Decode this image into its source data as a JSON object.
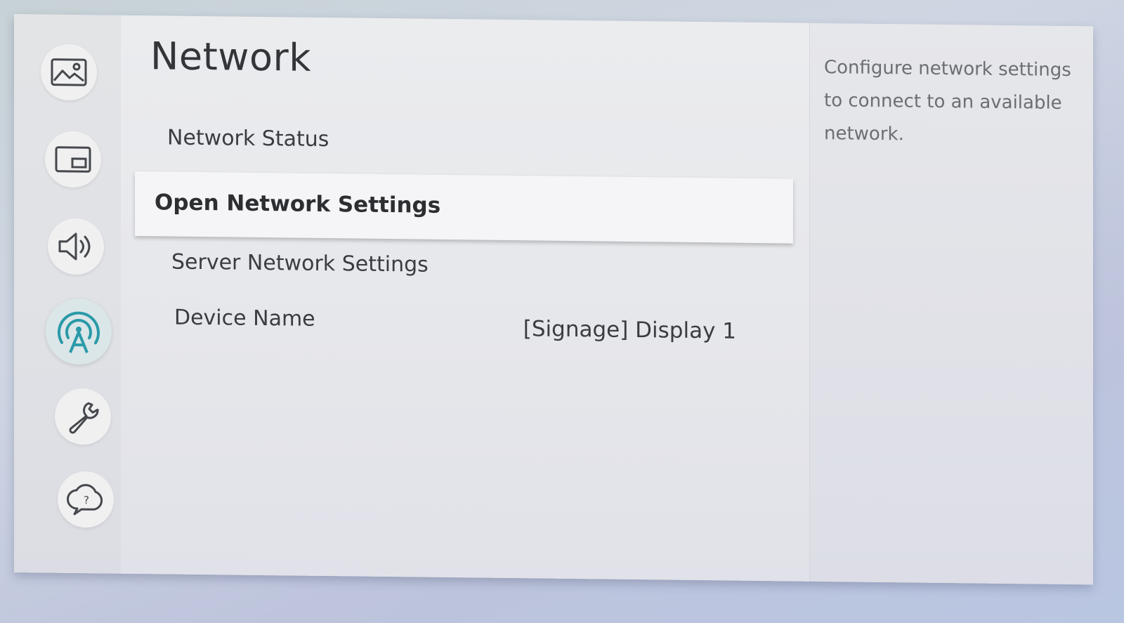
{
  "sidebar": {
    "items": [
      {
        "icon": "picture-icon",
        "label": ""
      },
      {
        "icon": "picture-in-picture-icon",
        "label": ""
      },
      {
        "icon": "sound-icon",
        "label": ""
      },
      {
        "icon": "network-icon",
        "label": "",
        "selected": true
      },
      {
        "icon": "wrench-icon",
        "label": ""
      },
      {
        "icon": "support-icon",
        "label": ""
      }
    ]
  },
  "main": {
    "title": "Network",
    "items": [
      {
        "label": "Network Status"
      },
      {
        "label": "Open Network Settings",
        "focused": true
      },
      {
        "label": "Server Network Settings"
      },
      {
        "label": "Device Name",
        "value": "[Signage] Display 1"
      }
    ]
  },
  "description": {
    "text": "Configure network settings to connect to an available network."
  },
  "colors": {
    "accent": "#2a9aa8",
    "icon_stroke": "#45484c"
  }
}
